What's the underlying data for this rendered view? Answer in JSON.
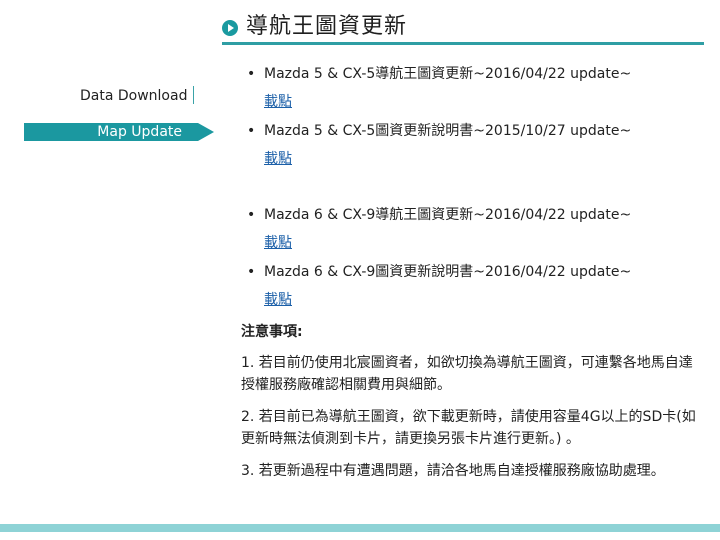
{
  "header": {
    "title": "導航王圖資更新"
  },
  "sidebar": {
    "items": [
      {
        "label": "Data Download",
        "active": false
      },
      {
        "label": "Map Update",
        "active": true
      }
    ]
  },
  "content": {
    "items": [
      {
        "title": "Mazda 5 & CX-5導航王圖資更新~2016/04/22 update~",
        "link": "載點"
      },
      {
        "title": "Mazda 5 & CX-5圖資更新說明書~2015/10/27 update~",
        "link": "載點"
      },
      {
        "title": "Mazda 6 & CX-9導航王圖資更新~2016/04/22 update~",
        "link": "載點"
      },
      {
        "title": "Mazda 6 & CX-9圖資更新說明書~2016/04/22 update~",
        "link": "載點"
      }
    ],
    "notes_heading": "注意事項:",
    "notes": [
      "1. 若目前仍使用北宸圖資者，如欲切換為導航王圖資，可連繫各地馬自達授權服務廠確認相關費用與細節。",
      "2. 若目前已為導航王圖資，欲下載更新時，請使用容量4G以上的SD卡(如更新時無法偵測到卡片，請更換另張卡片進行更新。) 。",
      "3. 若更新過程中有遭遇問題，請洽各地馬自達授權服務廠協助處理。"
    ]
  },
  "colors": {
    "accent": "#1b98a0",
    "link": "#1b5fa8",
    "footer": "#8ed3d6"
  }
}
